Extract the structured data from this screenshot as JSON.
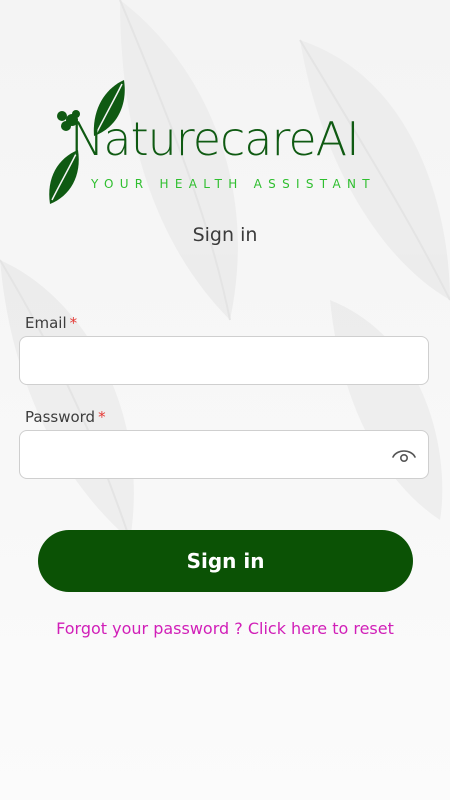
{
  "brand": {
    "name": "NaturecareAI",
    "tagline": "YOUR HEALTH ASSISTANT",
    "primary_color": "#0b5205",
    "accent_color": "#2fbf2f"
  },
  "page": {
    "subtitle": "Sign in"
  },
  "form": {
    "email": {
      "label": "Email",
      "required_mark": "*",
      "value": "",
      "placeholder": ""
    },
    "password": {
      "label": "Password",
      "required_mark": "*",
      "value": "",
      "placeholder": "",
      "toggle_icon": "eye-icon"
    },
    "submit_label": "Sign in"
  },
  "links": {
    "forgot_password": "Forgot your password ? Click here to reset",
    "link_color": "#d11fb8"
  }
}
